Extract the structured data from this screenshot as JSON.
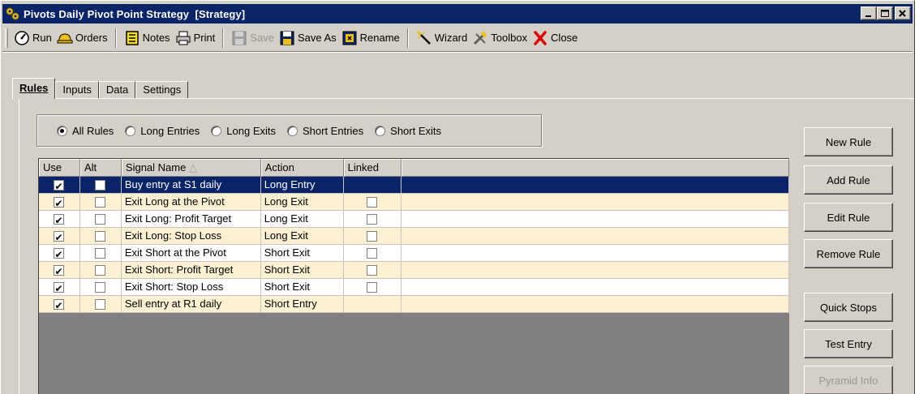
{
  "window": {
    "title": "Pivots Daily Pivot Point Strategy  [Strategy]",
    "controls": [
      "minimize",
      "maximize",
      "close"
    ]
  },
  "toolbar": {
    "run": "Run",
    "orders": "Orders",
    "notes": "Notes",
    "print": "Print",
    "save": "Save",
    "save_as": "Save As",
    "rename": "Rename",
    "wizard": "Wizard",
    "toolbox": "Toolbox",
    "close": "Close"
  },
  "tabs": [
    {
      "label": "Rules",
      "active": true
    },
    {
      "label": "Inputs",
      "active": false
    },
    {
      "label": "Data",
      "active": false
    },
    {
      "label": "Settings",
      "active": false
    }
  ],
  "filter": {
    "options": [
      "All Rules",
      "Long Entries",
      "Long Exits",
      "Short Entries",
      "Short Exits"
    ],
    "selected": "All Rules"
  },
  "grid": {
    "columns": [
      "Use",
      "Alt",
      "Signal Name",
      "Action",
      "Linked"
    ],
    "sort_indicator": "△",
    "rows": [
      {
        "use": true,
        "alt": false,
        "name": "Buy entry at S1 daily",
        "action": "Long Entry",
        "linked": null,
        "selected": true
      },
      {
        "use": true,
        "alt": false,
        "name": "Exit Long at the Pivot",
        "action": "Long Exit",
        "linked": false
      },
      {
        "use": true,
        "alt": false,
        "name": "Exit Long: Profit Target",
        "action": "Long Exit",
        "linked": false
      },
      {
        "use": true,
        "alt": false,
        "name": "Exit Long: Stop Loss",
        "action": "Long Exit",
        "linked": false
      },
      {
        "use": true,
        "alt": false,
        "name": "Exit Short at the Pivot",
        "action": "Short Exit",
        "linked": false
      },
      {
        "use": true,
        "alt": false,
        "name": "Exit Short: Profit Target",
        "action": "Short Exit",
        "linked": false
      },
      {
        "use": true,
        "alt": false,
        "name": "Exit Short: Stop Loss",
        "action": "Short Exit",
        "linked": false
      },
      {
        "use": true,
        "alt": false,
        "name": "Sell entry at R1 daily",
        "action": "Short Entry",
        "linked": null
      }
    ]
  },
  "side_buttons": {
    "new_rule": "New Rule",
    "add_rule": "Add Rule",
    "edit_rule": "Edit Rule",
    "remove_rule": "Remove Rule",
    "quick_stops": "Quick Stops",
    "test_entry": "Test Entry",
    "pyramid_info": "Pyramid Info"
  },
  "colors": {
    "title_bar": "#0a246a",
    "selected_row": "#0a246a",
    "alt_row": "#fdf1d2",
    "face": "#d4d0c8",
    "grid_empty": "#808080"
  }
}
